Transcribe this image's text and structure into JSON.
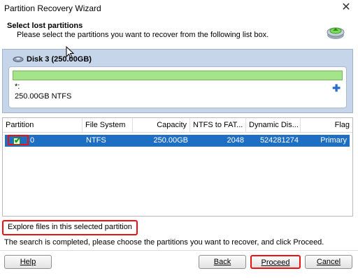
{
  "window": {
    "title": "Partition Recovery Wizard"
  },
  "header": {
    "title": "Select lost partitions",
    "subtitle": "Please select the partitions you want to recover from the following list box."
  },
  "disk": {
    "label": "Disk 3 (250.00GB)",
    "partition": {
      "name": "*:",
      "info": "250.00GB NTFS"
    }
  },
  "table": {
    "columns": [
      "Partition",
      "File System",
      "Capacity",
      "NTFS to FAT...",
      "Dynamic Dis...",
      "Flag"
    ],
    "rows": [
      {
        "partition": "0",
        "file_system": "NTFS",
        "capacity": "250.00GB",
        "ntfs_to_fat": "2048",
        "dynamic_disk": "524281274",
        "flag": "Primary",
        "checked": true
      }
    ]
  },
  "explore_label": "Explore files in this selected partition",
  "status_text": "The search is completed, please choose the partitions you want to recover, and click Proceed.",
  "buttons": {
    "help": "Help",
    "back": "Back",
    "proceed": "Proceed",
    "cancel": "Cancel"
  },
  "colors": {
    "selection": "#1e6fc4",
    "highlight_box": "#e11111",
    "partition_bar": "#a4e58a",
    "disk_panel": "#c6d5ea"
  }
}
